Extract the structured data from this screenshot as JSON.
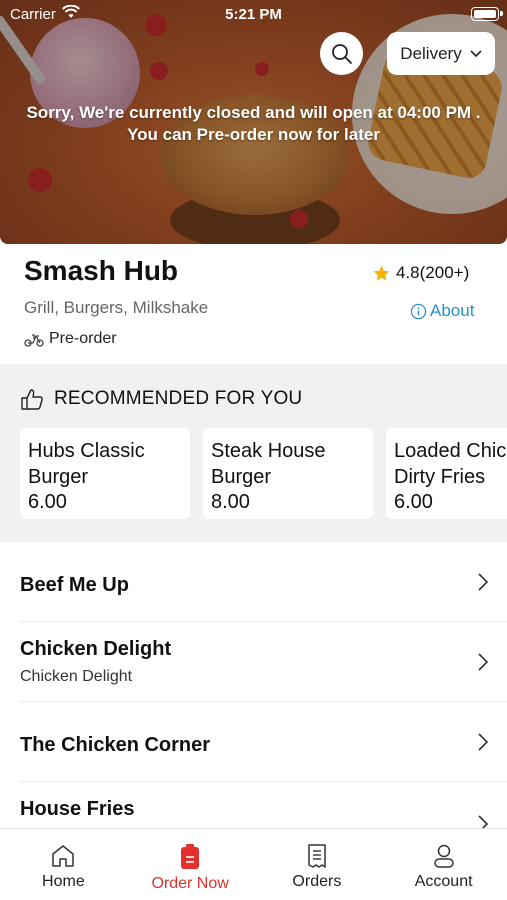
{
  "status_bar": {
    "carrier": "Carrier",
    "time": "5:21 PM"
  },
  "header": {
    "delivery_label": "Delivery",
    "closed_message_line1": "Sorry, We're currently closed and will open at 04:00 PM .",
    "closed_message_line2": "You can Pre-order now for later"
  },
  "restaurant": {
    "name": "Smash Hub",
    "rating": "4.8(200+)",
    "cuisine": "Grill, Burgers, Milkshake",
    "about_label": "About",
    "order_mode": "Pre-order"
  },
  "recommended": {
    "title": "RECOMMENDED FOR YOU",
    "items": [
      {
        "name": "Hubs Classic Burger",
        "price": "6.00"
      },
      {
        "name": "Steak House Burger",
        "price": "8.00"
      },
      {
        "name": "Loaded Chicken Dirty Fries",
        "price": "6.00"
      }
    ]
  },
  "categories": [
    {
      "name": "Beef Me Up",
      "subtitle": ""
    },
    {
      "name": "Chicken Delight",
      "subtitle": "Chicken Delight"
    },
    {
      "name": "The Chicken Corner",
      "subtitle": ""
    },
    {
      "name": "House Fries",
      "subtitle": ""
    }
  ],
  "tabs": [
    {
      "label": "Home",
      "icon": "home-icon"
    },
    {
      "label": "Order Now",
      "icon": "order-now-icon",
      "active": true
    },
    {
      "label": "Orders",
      "icon": "receipt-icon"
    },
    {
      "label": "Account",
      "icon": "account-icon"
    }
  ],
  "colors": {
    "accent": "#e3302f",
    "link": "#2a8fc9",
    "star": "#f5b400"
  }
}
